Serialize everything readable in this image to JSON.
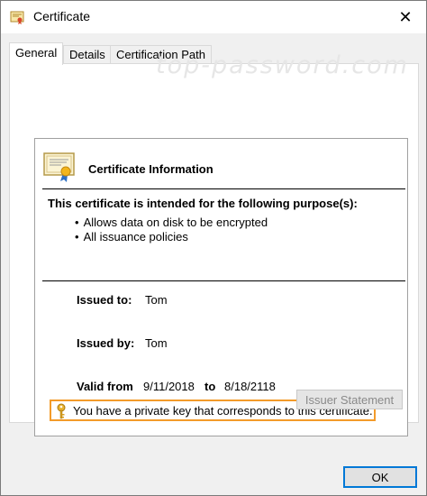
{
  "window": {
    "title": "Certificate",
    "close_glyph": "✕",
    "watermark": "top-password.com"
  },
  "tabs": [
    {
      "label": "General",
      "active": true
    },
    {
      "label": "Details",
      "active": false
    },
    {
      "label": "Certification Path",
      "active": false
    }
  ],
  "info": {
    "title": "Certificate Information",
    "purpose_heading": "This certificate is intended for the following purpose(s):",
    "purposes": [
      "Allows data on disk to be encrypted",
      "All issuance policies"
    ],
    "issued_to_label": "Issued to:",
    "issued_to_value": "Tom",
    "issued_by_label": "Issued by:",
    "issued_by_value": "Tom",
    "valid_from_label": "Valid from",
    "valid_from_value": "9/11/2018",
    "valid_to_label": "to",
    "valid_to_value": "8/18/2118",
    "private_key_text": "You have a private key that corresponds to this certificate."
  },
  "buttons": {
    "issuer_statement": "Issuer Statement",
    "ok": "OK"
  },
  "icons": {
    "window": "certificate-icon",
    "cert": "certificate-seal-icon",
    "key": "key-icon"
  },
  "colors": {
    "highlight_border": "#f39b2a",
    "focus_border": "#0078d7"
  }
}
